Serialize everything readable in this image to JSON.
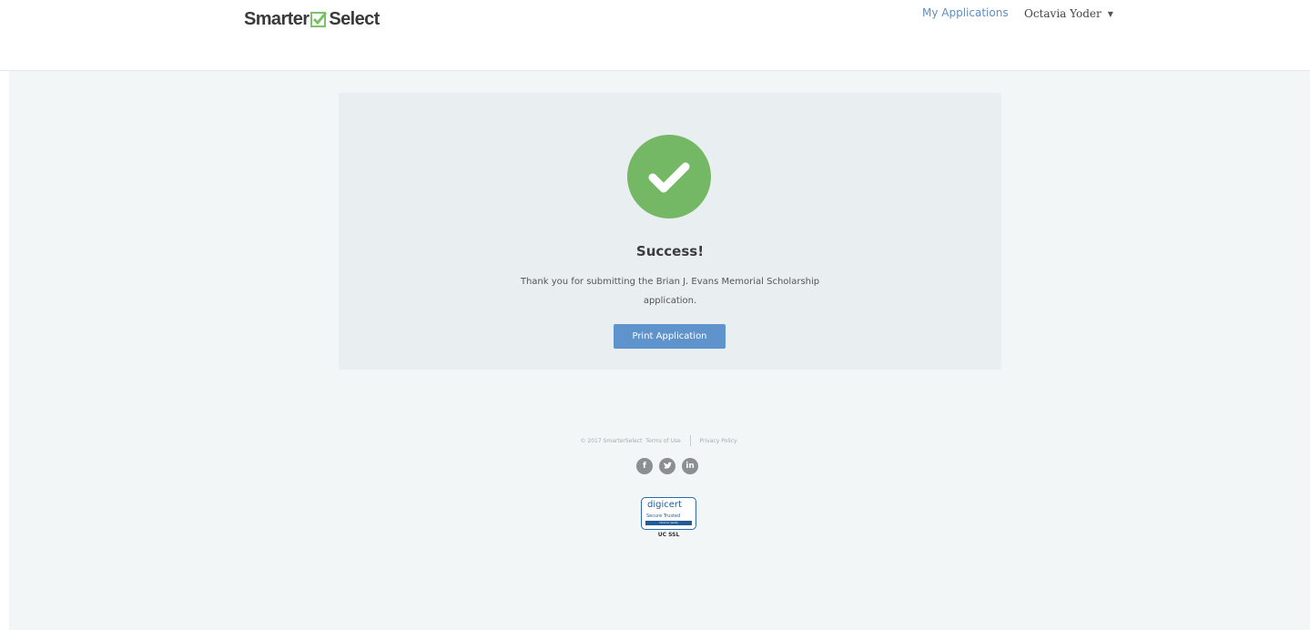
{
  "header": {
    "logo_left": "Smarter",
    "logo_right": "Select",
    "nav_link": "My Applications",
    "user_name": "Octavia Yoder"
  },
  "card": {
    "title": "Success!",
    "message": "Thank you for submitting the Brian J. Evans Memorial Scholarship application.",
    "button_label": "Print Application"
  },
  "footer": {
    "copyright": "© 2017 SmarterSelect",
    "terms_label": "Terms of Use",
    "privacy_label": "Privacy Policy",
    "social_icons": [
      "facebook-icon",
      "twitter-icon",
      "linkedin-icon"
    ],
    "badge": {
      "brand": "digicert",
      "secure_text": "Secure  Trusted",
      "verify_text": "Click to Verify",
      "caption": "UC SSL"
    }
  },
  "colors": {
    "accent": "#5e93cc",
    "success": "#74b866",
    "background": "#f3f6f6",
    "card": "#e9eef0"
  }
}
